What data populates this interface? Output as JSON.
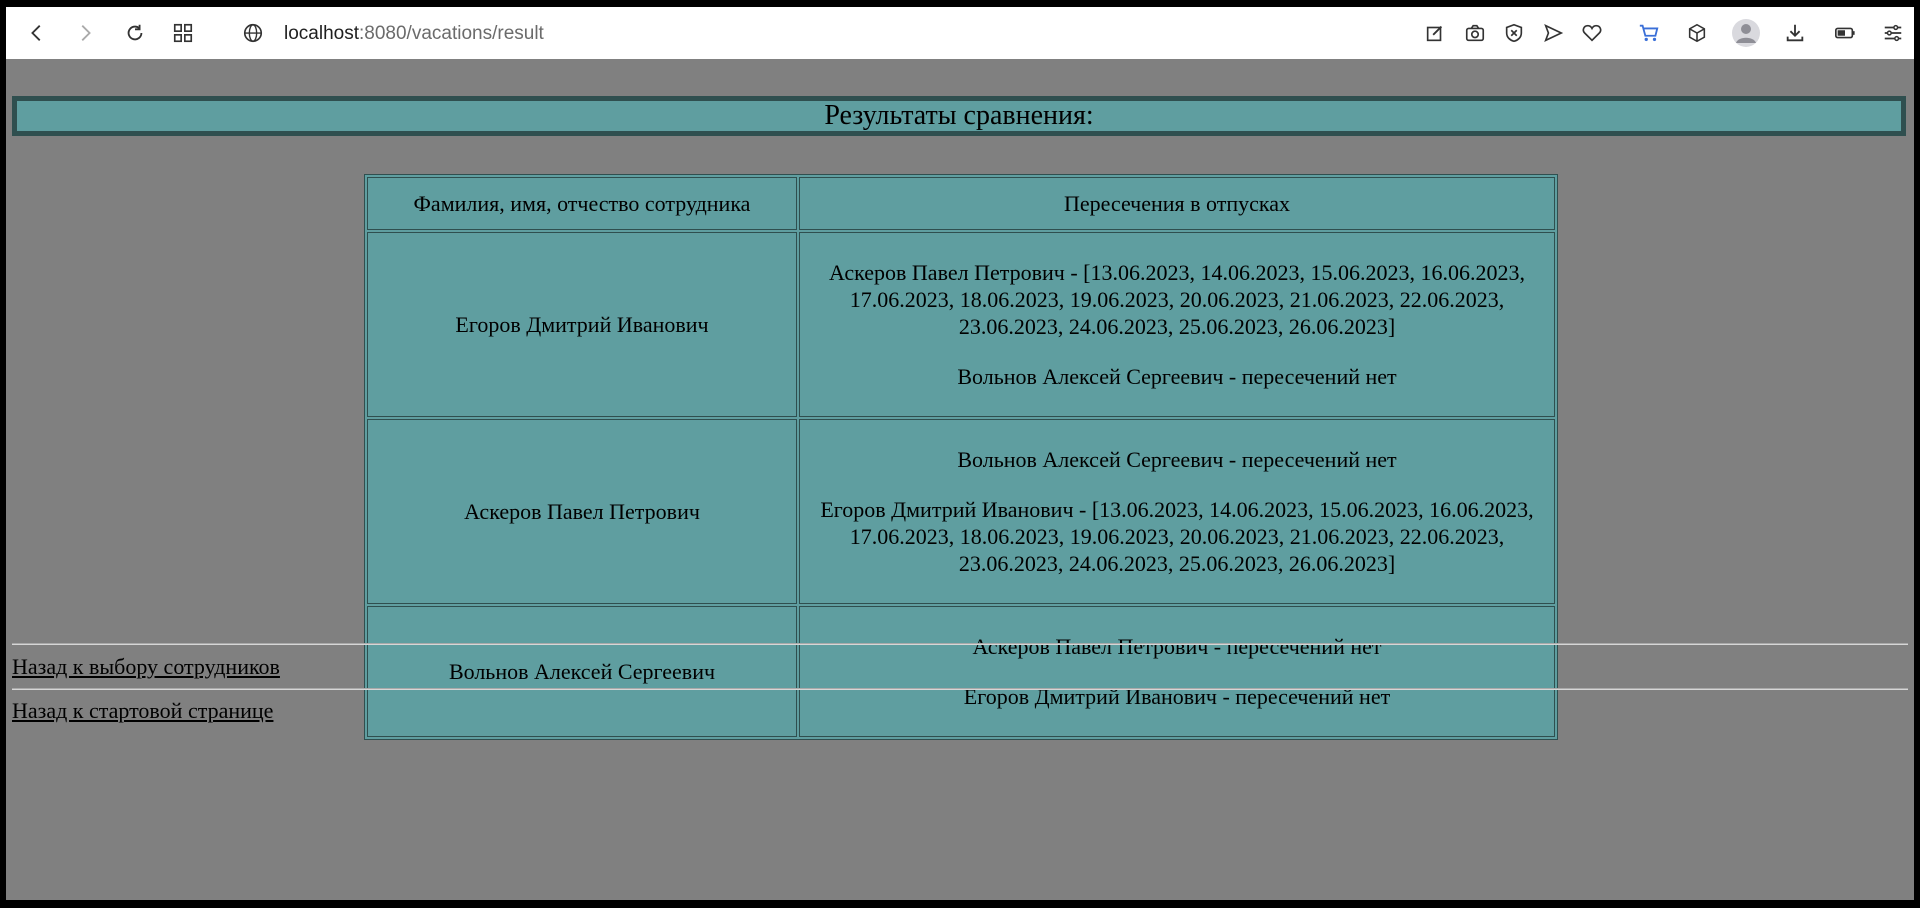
{
  "browser": {
    "url_host": "localhost",
    "url_rest": ":8080/vacations/result"
  },
  "page": {
    "heading": "Результаты сравнения:",
    "table": {
      "headers": [
        "Фамилия, имя, отчество сотрудника",
        "Пересечения в отпусках"
      ],
      "rows": [
        {
          "employee": "Егоров Дмитрий Иванович",
          "overlaps": [
            "Аскеров Павел Петрович - [13.06.2023, 14.06.2023, 15.06.2023, 16.06.2023, 17.06.2023, 18.06.2023, 19.06.2023, 20.06.2023, 21.06.2023, 22.06.2023, 23.06.2023, 24.06.2023, 25.06.2023, 26.06.2023]",
            "Вольнов Алексей Сергеевич - пересечений нет"
          ]
        },
        {
          "employee": "Аскеров Павел Петрович",
          "overlaps": [
            "Вольнов Алексей Сергеевич - пересечений нет",
            "Егоров Дмитрий Иванович - [13.06.2023, 14.06.2023, 15.06.2023, 16.06.2023, 17.06.2023, 18.06.2023, 19.06.2023, 20.06.2023, 21.06.2023, 22.06.2023, 23.06.2023, 24.06.2023, 25.06.2023, 26.06.2023]"
          ]
        },
        {
          "employee": "Вольнов Алексей Сергеевич",
          "overlaps": [
            "Аскеров Павел Петрович - пересечений нет",
            "Егоров Дмитрий Иванович - пересечений нет"
          ]
        }
      ]
    },
    "links": {
      "back_to_selection": "Назад к выбору сотрудников",
      "back_to_start": "Назад к стартовой странице"
    }
  },
  "colors": {
    "page_background": "#808080",
    "cell_background": "#5f9ea0",
    "border": "#2f4f4f"
  }
}
